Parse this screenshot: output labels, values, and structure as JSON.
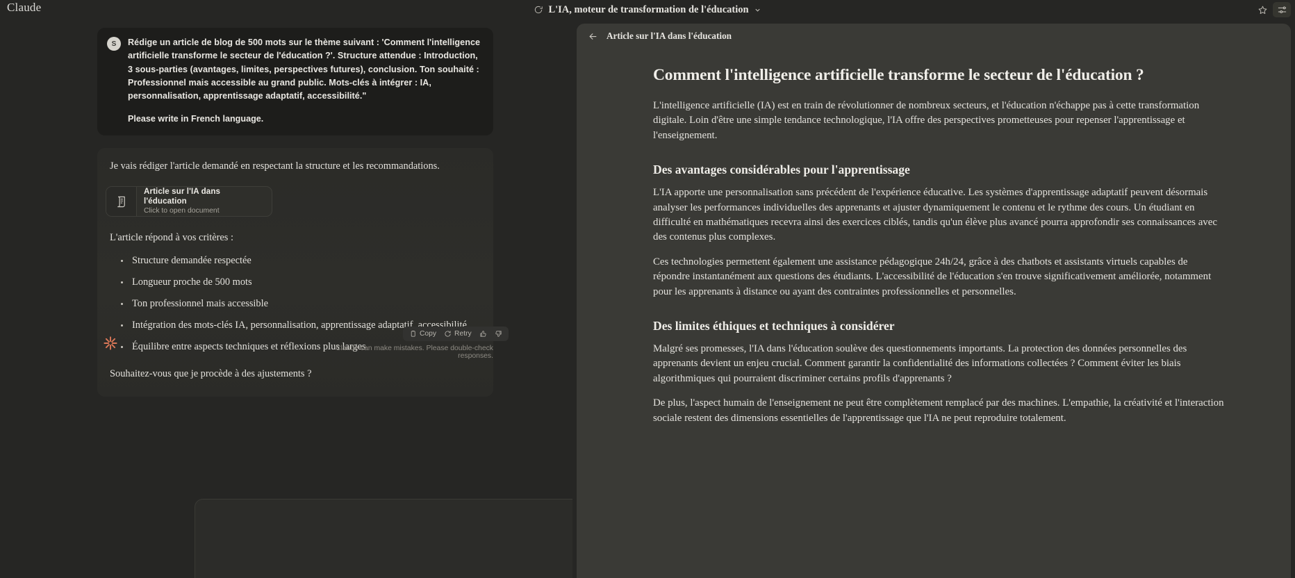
{
  "topbar": {
    "brand": "Claude",
    "chat_title": "L'IA, moteur de transformation de l'éducation",
    "chat_icon": "chat-bubble-icon",
    "chevron": "chevron-down-icon",
    "star_icon": "star-icon",
    "settings_icon": "sliders-icon"
  },
  "chat": {
    "user": {
      "avatar_initial": "S",
      "prompt": "Rédige un article de blog de 500 mots sur le thème suivant : 'Comment l'intelligence artificielle transforme le secteur de l'éducation ?'. Structure attendue : Introduction, 3 sous-parties (avantages, limites, perspectives futures), conclusion. Ton souhaité : Professionnel mais accessible au grand public. Mots-clés à intégrer : IA, personnalisation, apprentissage adaptatif, accessibilité.\"",
      "language_note": "Please write in French language."
    },
    "assistant": {
      "intro": "Je vais rédiger l'article demandé en respectant la structure et les recommandations.",
      "doc_card": {
        "icon": "document-scroll-icon",
        "title": "Article sur l'IA dans l'éducation",
        "subtitle": "Click to open document"
      },
      "criteria_lead": "L'article répond à vos critères :",
      "criteria": [
        "Structure demandée respectée",
        "Longueur proche de 500 mots",
        "Ton professionnel mais accessible",
        "Intégration des mots-clés IA, personnalisation, apprentissage adaptatif, accessibilité",
        "Équilibre entre aspects techniques et réflexions plus larges"
      ],
      "closing": "Souhaitez-vous que je procède à des ajustements ?"
    },
    "actions": {
      "copy_label": "Copy",
      "copy_icon": "clipboard-icon",
      "retry_label": "Retry",
      "retry_icon": "refresh-icon",
      "thumbs_up_icon": "thumbs-up-icon",
      "thumbs_down_icon": "thumbs-down-icon"
    },
    "footer_note": "Claude can make mistakes. Please double-check responses.",
    "logo_icon": "claude-sunburst-icon",
    "logo_color": "#d97757"
  },
  "document": {
    "back_icon": "back-arrow-icon",
    "header_title": "Article sur l'IA dans l'éducation",
    "h1": "Comment l'intelligence artificielle transforme le secteur de l'éducation ?",
    "intro": "L'intelligence artificielle (IA) est en train de révolutionner de nombreux secteurs, et l'éducation n'échappe pas à cette transformation digitale. Loin d'être une simple tendance technologique, l'IA offre des perspectives prometteuses pour repenser l'apprentissage et l'enseignement.",
    "section1_title": "Des avantages considérables pour l'apprentissage",
    "section1_p1": "L'IA apporte une personnalisation sans précédent de l'expérience éducative. Les systèmes d'apprentissage adaptatif peuvent désormais analyser les performances individuelles des apprenants et ajuster dynamiquement le contenu et le rythme des cours. Un étudiant en difficulté en mathématiques recevra ainsi des exercices ciblés, tandis qu'un élève plus avancé pourra approfondir ses connaissances avec des contenus plus complexes.",
    "section1_p2": "Ces technologies permettent également une assistance pédagogique 24h/24, grâce à des chatbots et assistants virtuels capables de répondre instantanément aux questions des étudiants. L'accessibilité de l'éducation s'en trouve significativement améliorée, notamment pour les apprenants à distance ou ayant des contraintes professionnelles et personnelles.",
    "section2_title": "Des limites éthiques et techniques à considérer",
    "section2_p1": "Malgré ses promesses, l'IA dans l'éducation soulève des questionnements importants. La protection des données personnelles des apprenants devient un enjeu crucial. Comment garantir la confidentialité des informations collectées ? Comment éviter les biais algorithmiques qui pourraient discriminer certains profils d'apprenants ?",
    "section2_p2": "De plus, l'aspect humain de l'enseignement ne peut être complètement remplacé par des machines. L'empathie, la créativité et l'interaction sociale restent des dimensions essentielles de l'apprentissage que l'IA ne peut reproduire totalement."
  }
}
